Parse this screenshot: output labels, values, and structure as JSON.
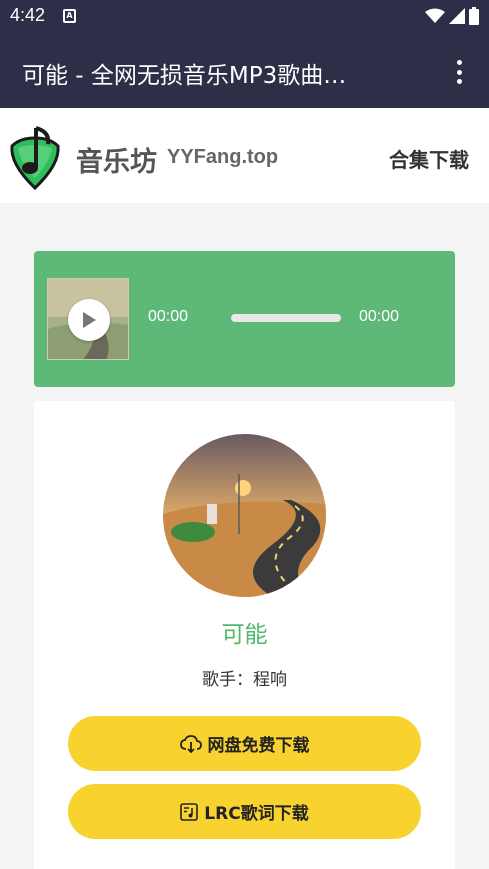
{
  "status_bar": {
    "time": "4:42",
    "notification_icon": "a-badge-icon",
    "icons": [
      "wifi-icon",
      "signal-icon",
      "battery-icon"
    ]
  },
  "app_bar": {
    "title": "可能 - 全网无损音乐MP3歌曲…",
    "menu_icon": "more-vert-icon"
  },
  "site_header": {
    "brand_cn": "音乐坊",
    "brand_domain": "YYFang.top",
    "collection_link": "合集下载"
  },
  "player": {
    "current_time": "00:00",
    "total_time": "00:00",
    "progress": 0,
    "play_icon": "play-icon"
  },
  "song": {
    "title": "可能",
    "singer": "歌手：程响"
  },
  "buttons": {
    "pan_download": "网盘免费下载",
    "lrc_download": "LRC歌词下载"
  },
  "colors": {
    "app_bar": "#2d2e47",
    "player_bg": "#5eb978",
    "song_title": "#4fb86b",
    "button_bg": "#f8d32f"
  }
}
